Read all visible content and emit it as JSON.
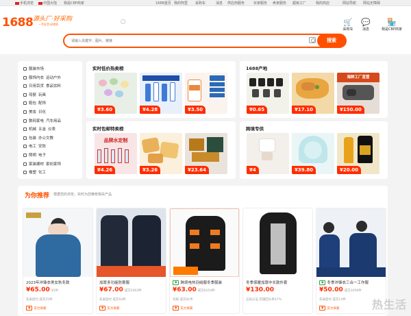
{
  "topbar": {
    "items": [
      "手机浏览",
      "中国大陆",
      "我是CBP商家",
      "1688首页",
      "我的阿里",
      "采购车",
      "消息",
      "供应商服务",
      "买家服务",
      "卖家服务",
      "超级工厂",
      "我的商店",
      "网站导航",
      "网站无障碍"
    ]
  },
  "header": {
    "logo": "1688",
    "slogan": "源头厂·好采购",
    "slogan_sub": "一手好货·好商家",
    "icons": [
      {
        "label": "采购车",
        "icon": "cart-icon",
        "glyph": "🛒"
      },
      {
        "label": "消息",
        "icon": "message-icon",
        "glyph": "💬"
      },
      {
        "label": "我是CBP商家",
        "icon": "store-icon",
        "glyph": "🏪"
      }
    ]
  },
  "search": {
    "placeholder": "请输入关键字、图片、链接",
    "button": "搜索"
  },
  "categories": [
    "服装市场",
    "服饰内衣",
    "运动户外",
    "日用百货",
    "食品饮料",
    "母婴",
    "玩具",
    "鞋包",
    "配饰",
    "美妆",
    "日化",
    "数码家电",
    "汽车用品",
    "机械",
    "五金",
    "仪表",
    "包装",
    "办公文教",
    "电工",
    "安防",
    "照明",
    "电子",
    "家装建材",
    "家纺家饰",
    "橡塑",
    "化工"
  ],
  "cat_rows": [
    [
      "服装市场"
    ],
    [
      "服饰内衣",
      "运动户外"
    ],
    [
      "日用百货",
      "食品饮料"
    ],
    [
      "母婴",
      "玩具"
    ],
    [
      "鞋包",
      "配饰"
    ],
    [
      "美妆",
      "日化"
    ],
    [
      "数码家电",
      "汽车用品"
    ],
    [
      "机械",
      "五金",
      "仪表"
    ],
    [
      "包装",
      "办公文教"
    ],
    [
      "电工",
      "安防"
    ],
    [
      "照明",
      "电子"
    ],
    [
      "家装建材",
      "家纺家饰"
    ],
    [
      "橡塑",
      "化工"
    ]
  ],
  "panels": {
    "deals": {
      "title": "实时低价热卖榜",
      "prices": [
        "¥3.60",
        "¥4.28",
        "¥3.50"
      ]
    },
    "origin": {
      "title": "1688产地",
      "prices": [
        "¥0.65",
        "¥17.10",
        "¥150.00"
      ],
      "banner": "海鲜工厂直营"
    },
    "free": {
      "title": "实时包邮特卖榜",
      "prices": [
        "¥4.26",
        "¥3.26",
        "¥23.64"
      ],
      "banner": "品牌水定制"
    },
    "hot": {
      "title": "跨境专供",
      "prices": [
        "¥4",
        "¥39.80",
        "¥20.00"
      ]
    }
  },
  "recommend": {
    "title": "为你推荐",
    "subtitle": "根据您的浏览，实时为您推荐相关产品",
    "cards": [
      {
        "title": "2023年冲锋衣男女秋冬款",
        "price": "¥65.00",
        "sold": "45件",
        "meta": "先采后付  成交25件",
        "badge": "实力商家"
      },
      {
        "title": "加厚多功能防寒服",
        "price": "¥67.00",
        "sold": "成交2003件",
        "meta": "先采后付  成交93件",
        "badge": "实力商家"
      },
      {
        "title": "跨境电热羽绒服冬季服装",
        "price": "¥63.00",
        "sold": "成交6354件",
        "meta": "包邮  成交81件",
        "badge": "实力商家"
      },
      {
        "title": "冬季保暖加厚中长款外套",
        "price": "¥130.00",
        "sold": "",
        "meta": "五钻认证  店铺回头率47%",
        "badge": ""
      },
      {
        "title": "冬季冲锋衣三合一工作服",
        "price": "¥50.00",
        "sold": "成交3456件",
        "meta": "先采后付  成交13件",
        "badge": "实力商家"
      }
    ]
  },
  "watermark": "热生活",
  "colors": {
    "brand": "#ff5000",
    "price": "#ff2d00"
  }
}
